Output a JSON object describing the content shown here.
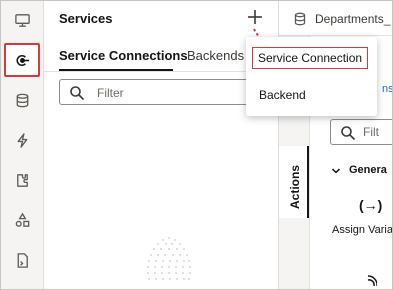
{
  "sidebar": {
    "items": [
      {
        "icon": "desktop-icon"
      },
      {
        "icon": "service-connection-icon",
        "selected": true
      },
      {
        "icon": "database-icon"
      },
      {
        "icon": "lightning-icon"
      },
      {
        "icon": "puzzle-icon"
      },
      {
        "icon": "shapes-icon"
      },
      {
        "icon": "document-icon"
      }
    ]
  },
  "services_panel": {
    "title": "Services",
    "tabs": [
      {
        "label": "Service Connections",
        "active": true
      },
      {
        "label": "Backends",
        "active": false
      }
    ],
    "filter_placeholder": "Filter"
  },
  "add_menu": {
    "items": [
      {
        "label": "Service Connection",
        "highlighted": true
      },
      {
        "label": "Backend",
        "highlighted": false
      }
    ]
  },
  "right_panel": {
    "header_title": "Departments_",
    "link_snip": "ns",
    "side_tab": "Actions",
    "filter_placeholder": "Filt",
    "group_label": "Genera",
    "action_glyph": "(→)",
    "action_label": "Assign Varia"
  },
  "colors": {
    "highlight_red": "#d9383f",
    "link_blue": "#1e6fb8",
    "text": "#161513"
  }
}
